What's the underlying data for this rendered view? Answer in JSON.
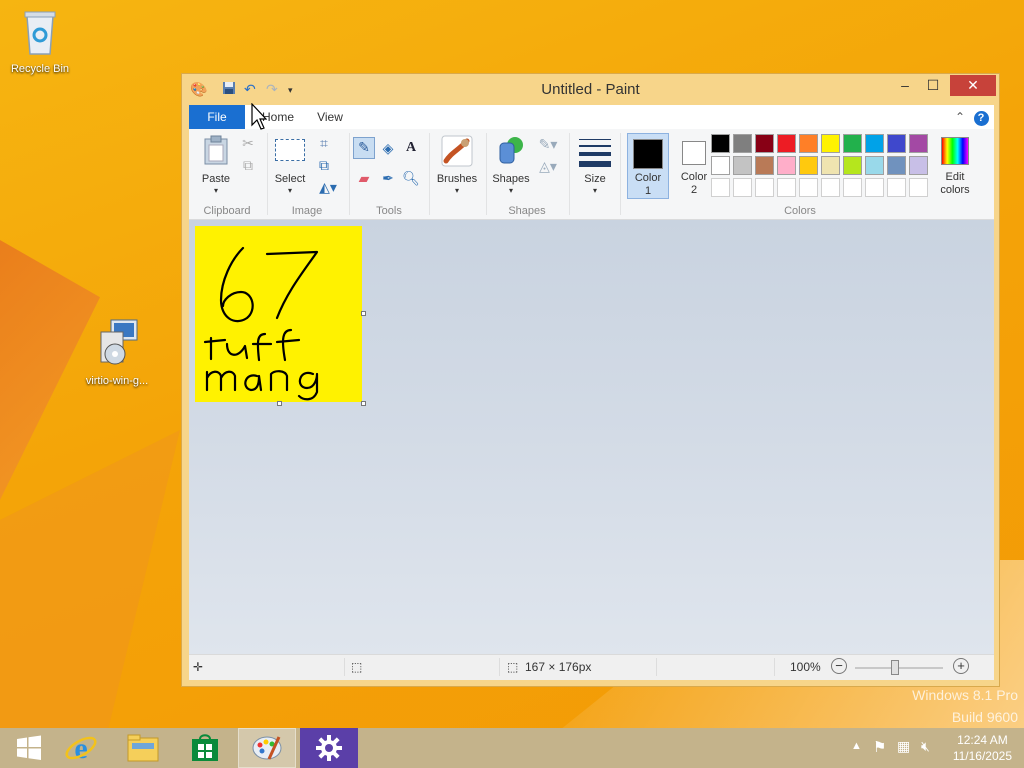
{
  "desktop": {
    "icons": [
      {
        "label": "Recycle Bin",
        "icon": "recycle-bin-icon"
      },
      {
        "label": "virtio-win-g...",
        "icon": "installer-icon"
      }
    ],
    "watermark": {
      "line1": "Windows 8.1 Pro",
      "line2": "Build 9600"
    }
  },
  "window": {
    "title": "Untitled - Paint",
    "controls": {
      "minimize": "–",
      "maximize": "☐",
      "close": "✕"
    }
  },
  "tabs": {
    "file": "File",
    "home": "Home",
    "view": "View"
  },
  "ribbon": {
    "clipboard": {
      "paste": "Paste",
      "group": "Clipboard"
    },
    "image": {
      "select": "Select",
      "group": "Image"
    },
    "tools": {
      "group": "Tools"
    },
    "brushes": {
      "label": "Brushes"
    },
    "shapes": {
      "label": "Shapes",
      "group": "Shapes"
    },
    "size": {
      "label": "Size"
    },
    "colors": {
      "color1_a": "Color",
      "color1_b": "1",
      "color2_a": "Color",
      "color2_b": "2",
      "edit_a": "Edit",
      "edit_b": "colors",
      "group": "Colors",
      "color1": "#000000",
      "color2": "#ffffff",
      "row1": [
        "#000000",
        "#7f7f7f",
        "#880015",
        "#ed1c24",
        "#ff7f27",
        "#fff200",
        "#22b14c",
        "#00a2e8",
        "#3f48cc",
        "#a349a4"
      ],
      "row2": [
        "#ffffff",
        "#c3c3c3",
        "#b97a57",
        "#ffaec9",
        "#ffc90e",
        "#efe4b0",
        "#b5e61d",
        "#99d9ea",
        "#7092be",
        "#c8bfe7"
      ],
      "row3": [
        "#ffffff",
        "#ffffff",
        "#ffffff",
        "#ffffff",
        "#ffffff",
        "#ffffff",
        "#ffffff",
        "#ffffff",
        "#ffffff",
        "#ffffff"
      ]
    }
  },
  "canvas": {
    "background": "#fff200",
    "drawing_text": {
      "line1": "67",
      "line2": "tuff",
      "line3": "mang"
    }
  },
  "status": {
    "image_size": "167 × 176px",
    "zoom": "100%",
    "zoom_level": 1.0
  },
  "taskbar": {
    "clock_time": "12:24 AM",
    "clock_date": "11/16/2025"
  }
}
